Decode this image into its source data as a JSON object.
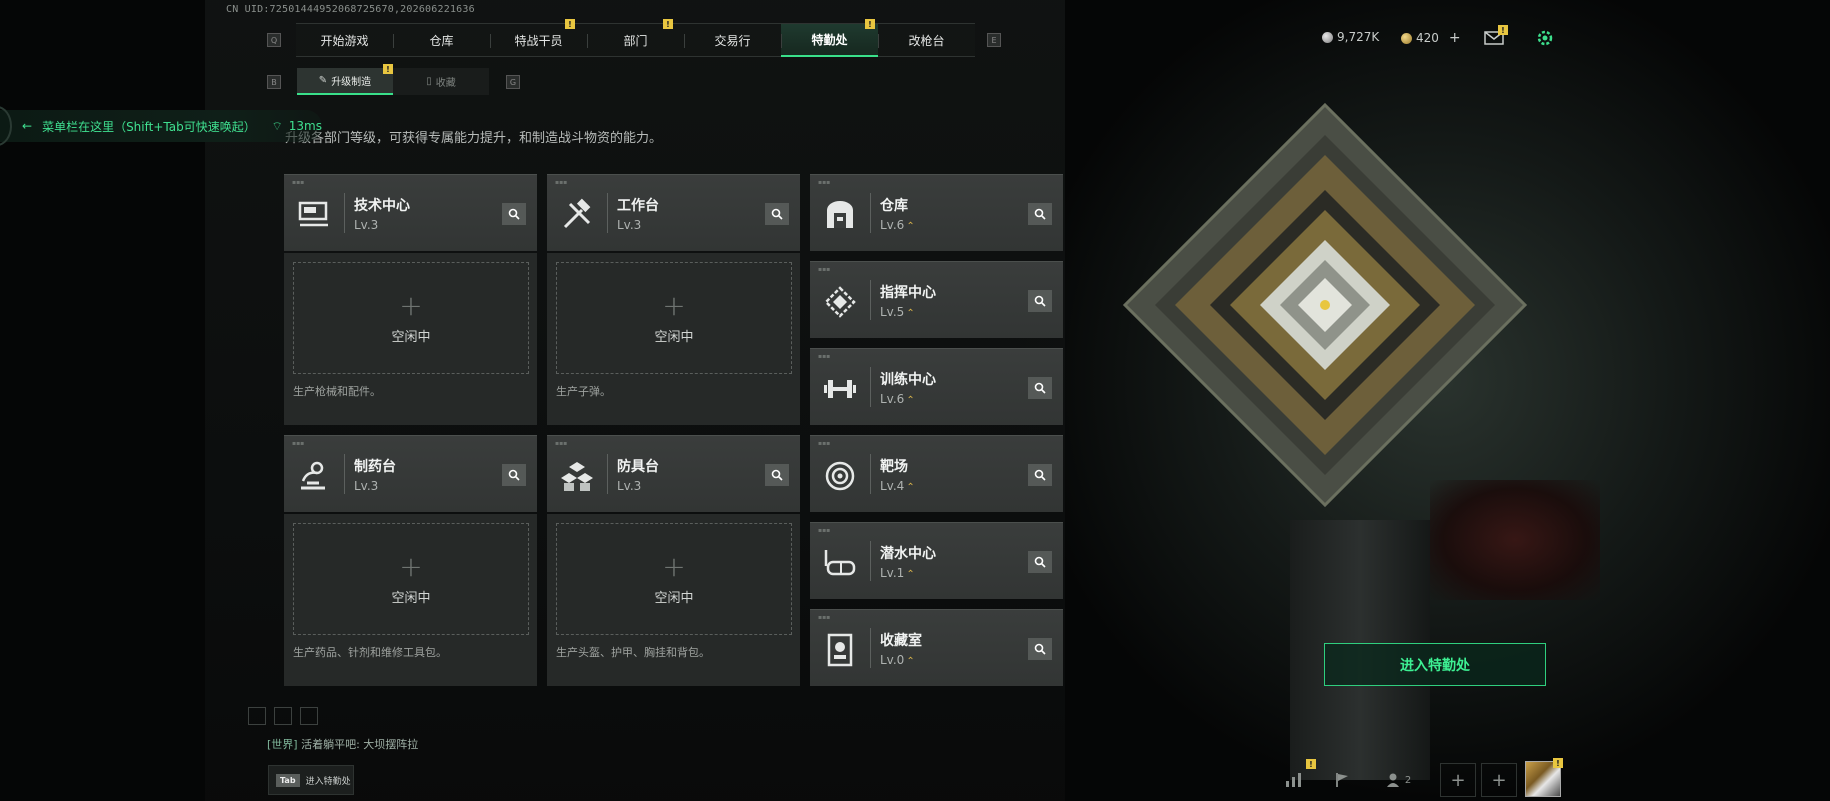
{
  "uid_text": "CN UID:72501444952068725670,202606221636",
  "nav": {
    "left_key": "Q",
    "right_key": "E",
    "tabs": [
      {
        "label": "开始游戏",
        "badge": ""
      },
      {
        "label": "仓库",
        "badge": ""
      },
      {
        "label": "特战干员",
        "badge": "!"
      },
      {
        "label": "部门",
        "badge": "!"
      },
      {
        "label": "交易行",
        "badge": ""
      },
      {
        "label": "特勤处",
        "badge": "!",
        "active": true
      },
      {
        "label": "改枪台",
        "badge": ""
      }
    ]
  },
  "subnav": {
    "left_key": "B",
    "right_key": "G",
    "tabs": [
      {
        "label": "升级制造",
        "badge": "!",
        "active": true
      },
      {
        "label": "收藏"
      }
    ]
  },
  "overlay": {
    "menu_hint": "菜单栏在这里（Shift+Tab可快速唤起）",
    "ping": "13ms"
  },
  "description": "升级各部门等级，可获得专属能力提升，和制造战斗物资的能力。",
  "workshops": [
    {
      "name": "技术中心",
      "level": "Lv.3",
      "icon": "tech-center-icon",
      "slot_status": "空闲中",
      "slot_plus": "+",
      "note": "生产枪械和配件。"
    },
    {
      "name": "工作台",
      "level": "Lv.3",
      "icon": "workbench-icon",
      "slot_status": "空闲中",
      "slot_plus": "+",
      "note": "生产子弹。"
    },
    {
      "name": "制药台",
      "level": "Lv.3",
      "icon": "pharmacy-icon",
      "slot_status": "空闲中",
      "slot_plus": "+",
      "note": "生产药品、针剂和维修工具包。"
    },
    {
      "name": "防具台",
      "level": "Lv.3",
      "icon": "armor-bench-icon",
      "slot_status": "空闲中",
      "slot_plus": "+",
      "note": "生产头盔、护甲、胸挂和背包。"
    }
  ],
  "facilities": [
    {
      "name": "仓库",
      "level": "Lv.6",
      "upgradable": true,
      "icon": "warehouse-icon"
    },
    {
      "name": "指挥中心",
      "level": "Lv.5",
      "upgradable": true,
      "icon": "command-center-icon"
    },
    {
      "name": "训练中心",
      "level": "Lv.6",
      "upgradable": true,
      "icon": "training-center-icon"
    },
    {
      "name": "靶场",
      "level": "Lv.4",
      "upgradable": true,
      "icon": "shooting-range-icon"
    },
    {
      "name": "潜水中心",
      "level": "Lv.1",
      "upgradable": true,
      "icon": "diving-center-icon"
    },
    {
      "name": "收藏室",
      "level": "Lv.0",
      "upgradable": true,
      "icon": "collection-room-icon"
    }
  ],
  "upgrade_glyph": "⌃",
  "resources": {
    "silver": "9,727K",
    "gold": "420",
    "gold_add": "+",
    "mail_badge": "!"
  },
  "enter_button": "进入特勤处",
  "chat": {
    "channel": "[世界]",
    "message": "活着躺平吧: 大坝摆阵拉"
  },
  "tab_hint": {
    "key": "Tab",
    "label": "进入特勤处"
  },
  "bottom": {
    "stats_badge": "!",
    "team_count": "2",
    "avatar_badge": "!",
    "add": "+"
  },
  "colors": {
    "accent": "#39e08a",
    "badge": "#e8c640",
    "upgrade": "#d4b04a"
  }
}
